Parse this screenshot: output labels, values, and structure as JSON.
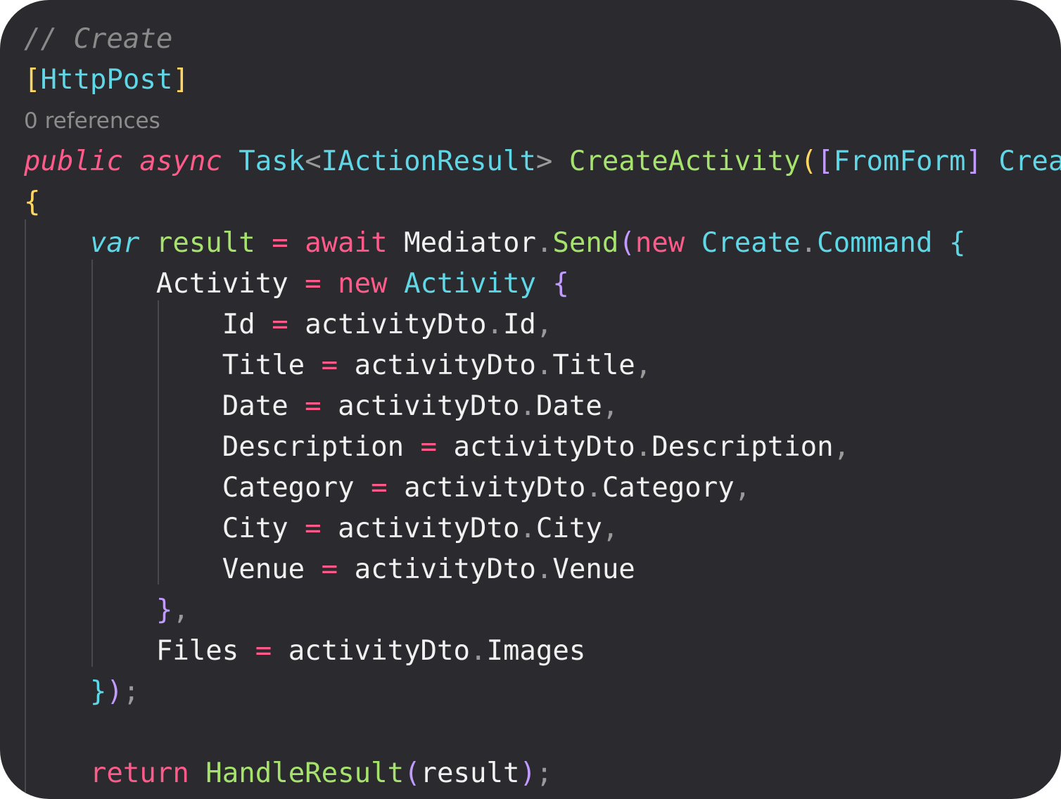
{
  "colors": {
    "background": "#2b2a2e",
    "comment": "#8a8a8a",
    "codelens": "#8c8c8c",
    "keyword": "#ff5b8a",
    "type": "#5fd7e6",
    "method": "#a6e36d",
    "identifier": "#f1f1f1",
    "punctuation": "#9a9a9a",
    "bracket1": "#ffd760",
    "bracket2": "#c29bff",
    "bracket3": "#5fd7e6",
    "indent_guide": "#49484d"
  },
  "code": {
    "lines": [
      {
        "kind": "code",
        "tokens": [
          {
            "text": "// Create",
            "color": "#8a8a8a",
            "italic": true
          }
        ]
      },
      {
        "kind": "code",
        "tokens": [
          {
            "text": "[",
            "color": "#ffd760"
          },
          {
            "text": "HttpPost",
            "color": "#5fd7e6"
          },
          {
            "text": "]",
            "color": "#ffd760"
          }
        ]
      },
      {
        "kind": "codelens",
        "text": "0 references"
      },
      {
        "kind": "code",
        "tokens": [
          {
            "text": "public",
            "color": "#ff5b8a",
            "italic": true
          },
          {
            "text": " "
          },
          {
            "text": "async",
            "color": "#ff5b8a",
            "italic": true
          },
          {
            "text": " "
          },
          {
            "text": "Task",
            "color": "#5fd7e6"
          },
          {
            "text": "<",
            "color": "#9a9a9a"
          },
          {
            "text": "IActionResult",
            "color": "#5fd7e6"
          },
          {
            "text": ">",
            "color": "#9a9a9a"
          },
          {
            "text": " "
          },
          {
            "text": "CreateActivity",
            "color": "#a6e36d"
          },
          {
            "text": "(",
            "color": "#ffd760"
          },
          {
            "text": "[",
            "color": "#c29bff"
          },
          {
            "text": "FromForm",
            "color": "#5fd7e6"
          },
          {
            "text": "]",
            "color": "#c29bff"
          },
          {
            "text": " "
          },
          {
            "text": "Crea",
            "color": "#5fd7e6"
          }
        ]
      },
      {
        "kind": "code",
        "tokens": [
          {
            "text": "{",
            "color": "#ffd760"
          }
        ]
      },
      {
        "kind": "code",
        "tokens": [
          {
            "text": "    "
          },
          {
            "text": "var",
            "color": "#5fd7e6",
            "italic": true
          },
          {
            "text": " "
          },
          {
            "text": "result",
            "color": "#a6e36d"
          },
          {
            "text": " "
          },
          {
            "text": "=",
            "color": "#ff5b8a"
          },
          {
            "text": " "
          },
          {
            "text": "await",
            "color": "#ff5b8a"
          },
          {
            "text": " "
          },
          {
            "text": "Mediator",
            "color": "#f1f1f1"
          },
          {
            "text": ".",
            "color": "#9a9a9a"
          },
          {
            "text": "Send",
            "color": "#a6e36d"
          },
          {
            "text": "(",
            "color": "#c29bff"
          },
          {
            "text": "new",
            "color": "#ff5b8a"
          },
          {
            "text": " "
          },
          {
            "text": "Create",
            "color": "#5fd7e6"
          },
          {
            "text": ".",
            "color": "#9a9a9a"
          },
          {
            "text": "Command",
            "color": "#5fd7e6"
          },
          {
            "text": " "
          },
          {
            "text": "{",
            "color": "#5fd7e6"
          }
        ]
      },
      {
        "kind": "code",
        "tokens": [
          {
            "text": "        "
          },
          {
            "text": "Activity",
            "color": "#f1f1f1"
          },
          {
            "text": " "
          },
          {
            "text": "=",
            "color": "#ff5b8a"
          },
          {
            "text": " "
          },
          {
            "text": "new",
            "color": "#ff5b8a"
          },
          {
            "text": " "
          },
          {
            "text": "Activity",
            "color": "#5fd7e6"
          },
          {
            "text": " "
          },
          {
            "text": "{",
            "color": "#c29bff"
          }
        ]
      },
      {
        "kind": "code",
        "tokens": [
          {
            "text": "            "
          },
          {
            "text": "Id",
            "color": "#f1f1f1"
          },
          {
            "text": " "
          },
          {
            "text": "=",
            "color": "#ff5b8a"
          },
          {
            "text": " "
          },
          {
            "text": "activityDto",
            "color": "#f1f1f1"
          },
          {
            "text": ".",
            "color": "#9a9a9a"
          },
          {
            "text": "Id",
            "color": "#f1f1f1"
          },
          {
            "text": ",",
            "color": "#9a9a9a"
          }
        ]
      },
      {
        "kind": "code",
        "tokens": [
          {
            "text": "            "
          },
          {
            "text": "Title",
            "color": "#f1f1f1"
          },
          {
            "text": " "
          },
          {
            "text": "=",
            "color": "#ff5b8a"
          },
          {
            "text": " "
          },
          {
            "text": "activityDto",
            "color": "#f1f1f1"
          },
          {
            "text": ".",
            "color": "#9a9a9a"
          },
          {
            "text": "Title",
            "color": "#f1f1f1"
          },
          {
            "text": ",",
            "color": "#9a9a9a"
          }
        ]
      },
      {
        "kind": "code",
        "tokens": [
          {
            "text": "            "
          },
          {
            "text": "Date",
            "color": "#f1f1f1"
          },
          {
            "text": " "
          },
          {
            "text": "=",
            "color": "#ff5b8a"
          },
          {
            "text": " "
          },
          {
            "text": "activityDto",
            "color": "#f1f1f1"
          },
          {
            "text": ".",
            "color": "#9a9a9a"
          },
          {
            "text": "Date",
            "color": "#f1f1f1"
          },
          {
            "text": ",",
            "color": "#9a9a9a"
          }
        ]
      },
      {
        "kind": "code",
        "tokens": [
          {
            "text": "            "
          },
          {
            "text": "Description",
            "color": "#f1f1f1"
          },
          {
            "text": " "
          },
          {
            "text": "=",
            "color": "#ff5b8a"
          },
          {
            "text": " "
          },
          {
            "text": "activityDto",
            "color": "#f1f1f1"
          },
          {
            "text": ".",
            "color": "#9a9a9a"
          },
          {
            "text": "Description",
            "color": "#f1f1f1"
          },
          {
            "text": ",",
            "color": "#9a9a9a"
          }
        ]
      },
      {
        "kind": "code",
        "tokens": [
          {
            "text": "            "
          },
          {
            "text": "Category",
            "color": "#f1f1f1"
          },
          {
            "text": " "
          },
          {
            "text": "=",
            "color": "#ff5b8a"
          },
          {
            "text": " "
          },
          {
            "text": "activityDto",
            "color": "#f1f1f1"
          },
          {
            "text": ".",
            "color": "#9a9a9a"
          },
          {
            "text": "Category",
            "color": "#f1f1f1"
          },
          {
            "text": ",",
            "color": "#9a9a9a"
          }
        ]
      },
      {
        "kind": "code",
        "tokens": [
          {
            "text": "            "
          },
          {
            "text": "City",
            "color": "#f1f1f1"
          },
          {
            "text": " "
          },
          {
            "text": "=",
            "color": "#ff5b8a"
          },
          {
            "text": " "
          },
          {
            "text": "activityDto",
            "color": "#f1f1f1"
          },
          {
            "text": ".",
            "color": "#9a9a9a"
          },
          {
            "text": "City",
            "color": "#f1f1f1"
          },
          {
            "text": ",",
            "color": "#9a9a9a"
          }
        ]
      },
      {
        "kind": "code",
        "tokens": [
          {
            "text": "            "
          },
          {
            "text": "Venue",
            "color": "#f1f1f1"
          },
          {
            "text": " "
          },
          {
            "text": "=",
            "color": "#ff5b8a"
          },
          {
            "text": " "
          },
          {
            "text": "activityDto",
            "color": "#f1f1f1"
          },
          {
            "text": ".",
            "color": "#9a9a9a"
          },
          {
            "text": "Venue",
            "color": "#f1f1f1"
          }
        ]
      },
      {
        "kind": "code",
        "tokens": [
          {
            "text": "        "
          },
          {
            "text": "}",
            "color": "#c29bff"
          },
          {
            "text": ",",
            "color": "#9a9a9a"
          }
        ]
      },
      {
        "kind": "code",
        "tokens": [
          {
            "text": "        "
          },
          {
            "text": "Files",
            "color": "#f1f1f1"
          },
          {
            "text": " "
          },
          {
            "text": "=",
            "color": "#ff5b8a"
          },
          {
            "text": " "
          },
          {
            "text": "activityDto",
            "color": "#f1f1f1"
          },
          {
            "text": ".",
            "color": "#9a9a9a"
          },
          {
            "text": "Images",
            "color": "#f1f1f1"
          }
        ]
      },
      {
        "kind": "code",
        "tokens": [
          {
            "text": "    "
          },
          {
            "text": "}",
            "color": "#5fd7e6"
          },
          {
            "text": ")",
            "color": "#c29bff"
          },
          {
            "text": ";",
            "color": "#9a9a9a"
          }
        ]
      },
      {
        "kind": "code",
        "tokens": []
      },
      {
        "kind": "code",
        "tokens": [
          {
            "text": "    "
          },
          {
            "text": "return",
            "color": "#ff5b8a"
          },
          {
            "text": " "
          },
          {
            "text": "HandleResult",
            "color": "#a6e36d"
          },
          {
            "text": "(",
            "color": "#c29bff"
          },
          {
            "text": "result",
            "color": "#f1f1f1"
          },
          {
            "text": ")",
            "color": "#c29bff"
          },
          {
            "text": ";",
            "color": "#9a9a9a"
          }
        ]
      }
    ]
  }
}
